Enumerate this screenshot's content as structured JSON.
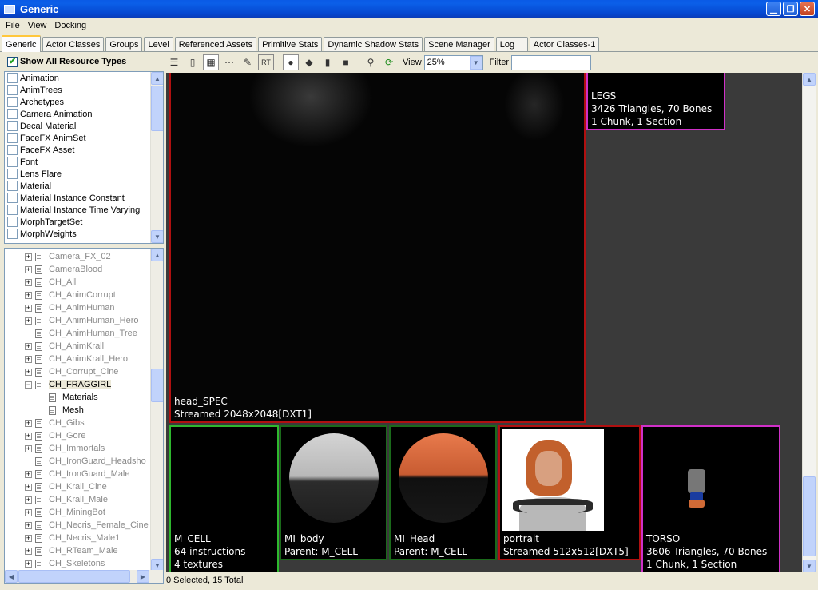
{
  "window": {
    "title": "Generic"
  },
  "menu": [
    "File",
    "View",
    "Docking"
  ],
  "tabs": [
    "Generic",
    "Actor Classes",
    "Groups",
    "Level",
    "Referenced Assets",
    "Primitive Stats",
    "Dynamic Shadow Stats",
    "Scene Manager",
    "Log",
    "Actor Classes-1"
  ],
  "left": {
    "show_all_label": "Show All Resource Types",
    "resource_types": [
      "Animation",
      "AnimTrees",
      "Archetypes",
      "Camera Animation",
      "Decal Material",
      "FaceFX AnimSet",
      "FaceFX Asset",
      "Font",
      "Lens Flare",
      "Material",
      "Material Instance Constant",
      "Material Instance Time Varying",
      "MorphTargetSet",
      "MorphWeights"
    ],
    "tree": [
      {
        "label": "Camera_FX_02",
        "exp": "+"
      },
      {
        "label": "CameraBlood",
        "exp": "+"
      },
      {
        "label": "CH_All",
        "exp": "+"
      },
      {
        "label": "CH_AnimCorrupt",
        "exp": "+"
      },
      {
        "label": "CH_AnimHuman",
        "exp": "+"
      },
      {
        "label": "CH_AnimHuman_Hero",
        "exp": "+"
      },
      {
        "label": "CH_AnimHuman_Tree",
        "exp": ""
      },
      {
        "label": "CH_AnimKrall",
        "exp": "+"
      },
      {
        "label": "CH_AnimKrall_Hero",
        "exp": "+"
      },
      {
        "label": "CH_Corrupt_Cine",
        "exp": "+"
      },
      {
        "label": "CH_FRAGGIRL",
        "exp": "-",
        "selected": true
      },
      {
        "label": "Materials",
        "child": true
      },
      {
        "label": "Mesh",
        "child": true
      },
      {
        "label": "CH_Gibs",
        "exp": "+"
      },
      {
        "label": "CH_Gore",
        "exp": "+"
      },
      {
        "label": "CH_Immortals",
        "exp": "+"
      },
      {
        "label": "CH_IronGuard_Headsho",
        "exp": ""
      },
      {
        "label": "CH_IronGuard_Male",
        "exp": "+"
      },
      {
        "label": "CH_Krall_Cine",
        "exp": "+"
      },
      {
        "label": "CH_Krall_Male",
        "exp": "+"
      },
      {
        "label": "CH_MiningBot",
        "exp": "+"
      },
      {
        "label": "CH_Necris_Female_Cine",
        "exp": "+"
      },
      {
        "label": "CH_Necris_Male1",
        "exp": "+"
      },
      {
        "label": "CH_RTeam_Male",
        "exp": "+"
      },
      {
        "label": "CH_Skeletons",
        "exp": "+"
      }
    ]
  },
  "toolbar": {
    "view_label": "View",
    "view_value": "25%",
    "filter_label": "Filter"
  },
  "tiles": {
    "head_spec": {
      "line1": "head_SPEC",
      "line2": "Streamed 2048x2048[DXT1]"
    },
    "legs": {
      "line1": "LEGS",
      "line2": "3426 Triangles, 70 Bones",
      "line3": "1 Chunk, 1 Section"
    },
    "m_cell": {
      "line1": "M_CELL",
      "line2": "64 instructions",
      "line3": "4 textures"
    },
    "mi_body": {
      "line1": "MI_body",
      "line2": "Parent: M_CELL"
    },
    "mi_head": {
      "line1": "MI_Head",
      "line2": "Parent: M_CELL"
    },
    "portrait": {
      "line1": "portrait",
      "line2": "Streamed 512x512[DXT5]"
    },
    "torso": {
      "line1": "TORSO",
      "line2": "3606 Triangles, 70 Bones",
      "line3": "1 Chunk, 1 Section"
    }
  },
  "status": "0 Selected, 15 Total",
  "colors": {
    "material_border": "#2eb82e",
    "texture_border": "#b01010",
    "mesh_border": "#d030c8",
    "viewport_bg": "#3a3a3a"
  }
}
